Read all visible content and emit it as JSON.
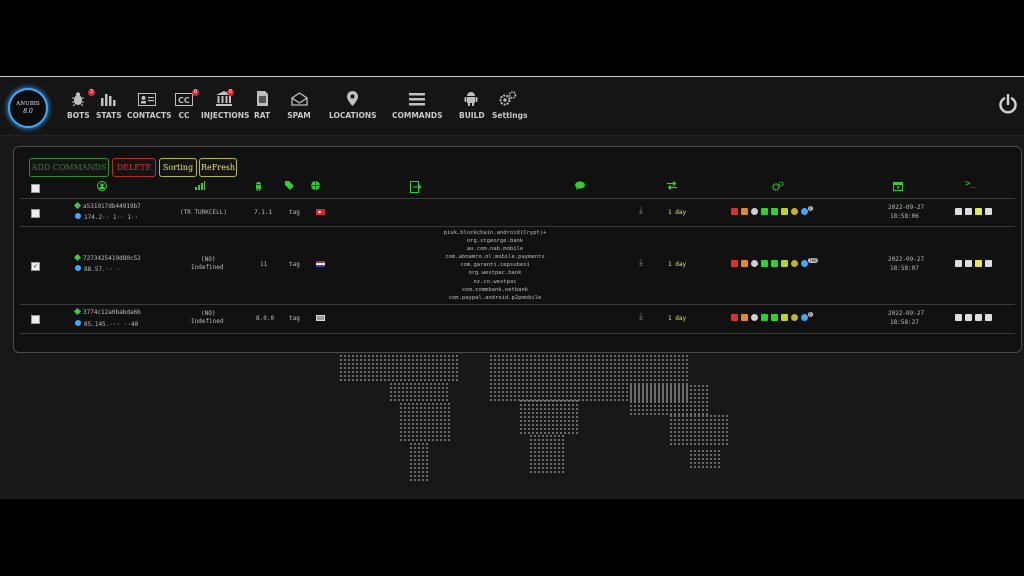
{
  "app": {
    "logo_line1": "ANUBIS",
    "logo_version": "8.0"
  },
  "nav": [
    {
      "label": "BOTS",
      "icon": "bug-icon",
      "badge": "3"
    },
    {
      "label": "STATS",
      "icon": "bar-chart-icon",
      "badge": ""
    },
    {
      "label": "CONTACTS",
      "icon": "contact-card-icon",
      "badge": ""
    },
    {
      "label": "CC",
      "icon": "credit-card-icon",
      "badge": "0"
    },
    {
      "label": "INJECTIONS",
      "icon": "bank-icon",
      "badge": "0"
    },
    {
      "label": "RAT",
      "icon": "sim-card-icon",
      "badge": ""
    },
    {
      "label": "SPAM",
      "icon": "envelope-icon",
      "badge": ""
    },
    {
      "label": "LOCATIONS",
      "icon": "map-pin-icon",
      "badge": ""
    },
    {
      "label": "COMMANDS",
      "icon": "list-icon",
      "badge": ""
    },
    {
      "label": "BUILD",
      "icon": "android-icon",
      "badge": ""
    },
    {
      "label": "Settings",
      "icon": "gears-icon",
      "badge": ""
    }
  ],
  "toolbar": {
    "add": "ADD COMMANDS",
    "delete": "DELETE",
    "sorting": "Sorting",
    "refresh": "ReFresh"
  },
  "rows": [
    {
      "id": "a531917db44919b7",
      "ip": "174.2·· 1·· 1··",
      "operator": "(TR TURKCELL)",
      "operator2": "",
      "android": "7.1.1",
      "tag": "tag",
      "flag": "tr",
      "packages": [],
      "activity": "1 day",
      "checked": false,
      "date": "2022-09-27",
      "time": "18:58:06",
      "badge": "0"
    },
    {
      "id": "7273425419d80c52",
      "ip": "88.57.·· ·",
      "operator": "(NO)",
      "operator2": "Indefined",
      "android": "11",
      "tag": "tag",
      "flag": "nl",
      "packages": [
        "piuk.blockchain.android(Crypt)+",
        "org.stgeorge.bank",
        "au.com.nab.mobile",
        "com.abnamro.nl.mobile.payments",
        "com.garanti.cepsubesi",
        "org.westpac.bank",
        "nz.co.westpac",
        "com.commbank.netbank",
        "com.paypal.android.p2pmobile"
      ],
      "activity": "1 day",
      "checked": true,
      "date": "2022-09-27",
      "time": "18:58:07",
      "badge": "789"
    },
    {
      "id": "3774c12a0babda6b",
      "ip": "85.145.··· ··40",
      "operator": "(NO)",
      "operator2": "Indefined",
      "android": "8.0.0",
      "tag": "tag",
      "flag": "unknown",
      "packages": [],
      "activity": "1 day",
      "checked": false,
      "date": "2022-09-27",
      "time": "18:58:27",
      "badge": "0"
    }
  ],
  "colors": {
    "accent_green": "#2fd02f",
    "date_yellow": "#e6e65a",
    "delete_red": "#d23a3a"
  }
}
